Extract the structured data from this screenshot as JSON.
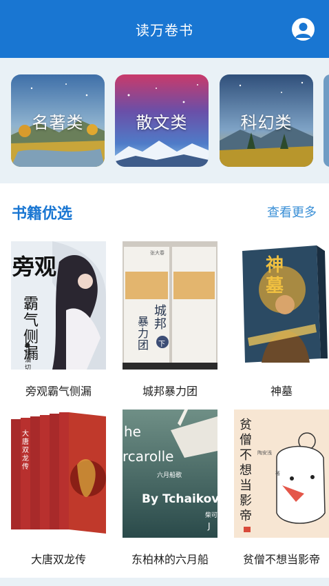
{
  "header": {
    "title": "读万卷书",
    "profile_icon": "user-icon"
  },
  "categories": [
    {
      "label": "名著类"
    },
    {
      "label": "散文类"
    },
    {
      "label": "科幻类"
    }
  ],
  "section": {
    "title": "书籍优选",
    "more": "查看更多"
  },
  "books": [
    {
      "title": "旁观霸气侧漏",
      "cover_text": [
        "旁观",
        "霸气侧漏",
        "●蘇油切"
      ]
    },
    {
      "title": "城邦暴力团",
      "cover_text": [
        "张大春",
        "城邦",
        "暴力团",
        "下"
      ]
    },
    {
      "title": "神墓",
      "cover_text": [
        "神墓"
      ]
    },
    {
      "title": "大唐双龙传",
      "cover_text": [
        "大唐双龙传"
      ]
    },
    {
      "title": "东柏林的六月船",
      "cover_text": [
        "he",
        "rcarolle",
        "六月船歌",
        "By  Tchaikov",
        "柴可",
        "J"
      ]
    },
    {
      "title": "贫僧不想当影帝",
      "cover_text": [
        "贫僧不想当影帝",
        "陶安浅",
        "著"
      ]
    }
  ],
  "colors": {
    "header_bg": "#1976d2",
    "accent": "#1976d2",
    "strip_bg": "#e9f1f6"
  }
}
